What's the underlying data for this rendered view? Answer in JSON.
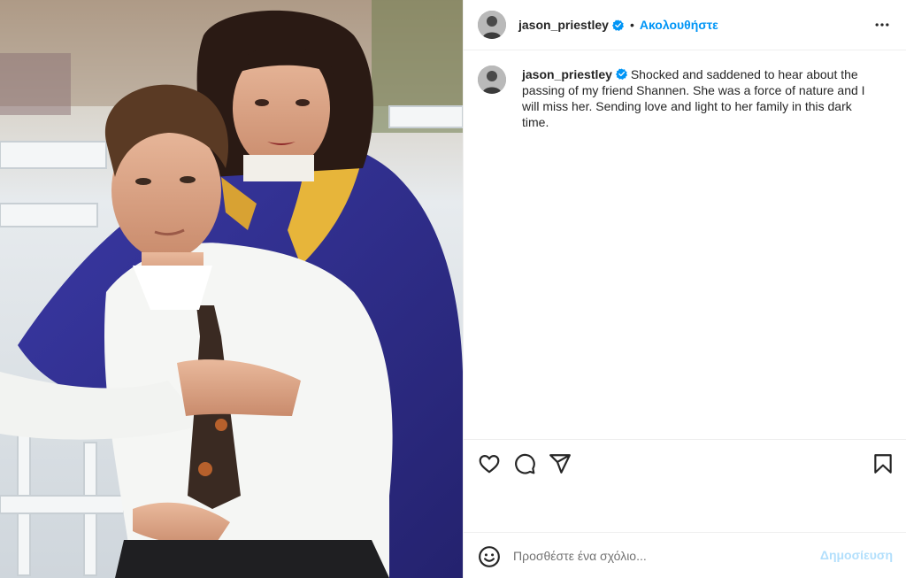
{
  "post": {
    "username": "jason_priestley",
    "follow_label": "Ακολουθήστε",
    "separator": "•",
    "caption": "Shocked and saddened to hear about the passing of my friend Shannen. She was a force of nature and I will miss her. Sending love and light to her family in this dark time."
  },
  "comment_box": {
    "placeholder": "Προσθέστε ένα σχόλιο...",
    "post_label": "Δημοσίευση"
  },
  "icons": {
    "verified": "verified-badge-icon",
    "more": "more-options-icon",
    "like": "heart-icon",
    "comment": "comment-icon",
    "share": "paper-plane-icon",
    "save": "bookmark-icon",
    "emoji": "emoji-icon"
  },
  "colors": {
    "follow_blue": "#0095f6",
    "post_disabled": "#b2dffc",
    "text": "#262626",
    "divider": "#efefef"
  }
}
